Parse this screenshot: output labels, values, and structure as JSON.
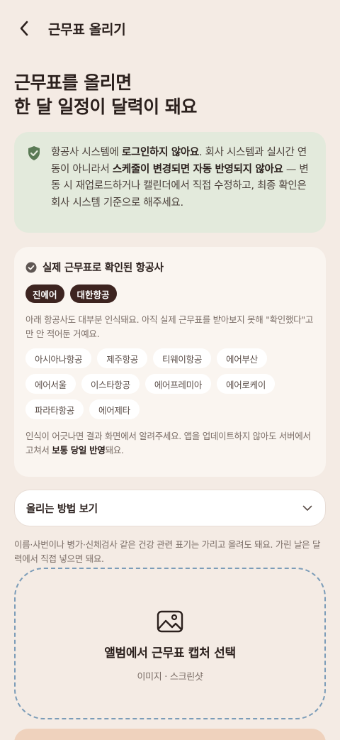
{
  "header": {
    "title": "근무표 올리기"
  },
  "hero": {
    "line1": "근무표를 올리면",
    "line2": "한 달 일정이 달력이 돼요"
  },
  "notice": {
    "t1": "항공사 시스템에 ",
    "b1": "로그인하지 않아요",
    "t2": ". 회사 시스템과 실시간 연동이 아니라서 ",
    "b2": "스케줄이 변경되면 자동 반영되지 않아요",
    "t3": " — 변동 시 재업로드하거나 캘린더에서 직접 수정하고, 최종 확인은 회사 시스템 기준으로 해주세요."
  },
  "airlines": {
    "title": "실제 근무표로 확인된 항공사",
    "confirmed": [
      "진에어",
      "대한항공"
    ],
    "description": "아래 항공사도 대부분 인식돼요. 아직 실제 근무표를 받아보지 못해 \"확인했다\"고만 안 적어둔 거예요.",
    "others": [
      "아시아나항공",
      "제주항공",
      "티웨이항공",
      "에어부산",
      "에어서울",
      "이스타항공",
      "에어프레미아",
      "에어로케이",
      "파라타항공",
      "에어제타"
    ],
    "foot_t1": "인식이 어긋나면 결과 화면에서 알려주세요. 앱을 업데이트하지 않아도 서버에서 고쳐서 ",
    "foot_b": "보통 당일 반영",
    "foot_t2": "돼요."
  },
  "howto": {
    "label": "올리는 방법 보기"
  },
  "privacy": "이름·사번이나 병가·신체검사 같은 건강 관련 표기는 가리고 올려도 돼요. 가린 날은 달력에서 직접 넣으면 돼요.",
  "upload": {
    "title": "앨범에서 근무표 캡처 선택",
    "subtitle": "이미지 · 스크린샷"
  },
  "colors": {
    "background": "#f4ebe4",
    "notice_bg": "#e3eadc",
    "chip_dark": "#3d2420",
    "dash": "#7b9cb8",
    "peek": "#efd2bd"
  },
  "icons": {
    "back": "chevron-left-icon",
    "shield": "shield-check-icon",
    "check": "check-circle-icon",
    "chevron": "chevron-down-icon",
    "image": "image-icon"
  }
}
